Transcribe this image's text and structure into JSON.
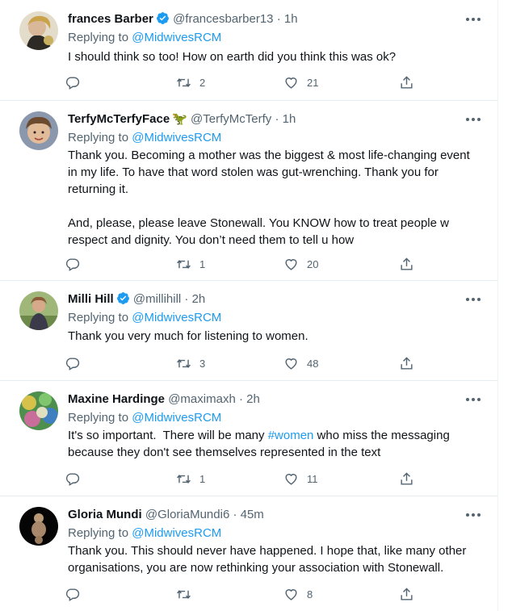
{
  "tweets": [
    {
      "name": "frances Barber",
      "verified": true,
      "emoji": "",
      "handle": "@francesbarber13",
      "time": "1h",
      "reply_prefix": "Replying to",
      "reply_handle": "@MidwivesRCM",
      "text_lines": [
        "I should think so too! How on earth did you think this was ok?"
      ],
      "counts": {
        "reply": "",
        "retweet": "2",
        "like": "21"
      },
      "avatar_colors": [
        "#d8c9a8",
        "#2d2a26"
      ]
    },
    {
      "name": "TerfyMcTerfyFace",
      "verified": false,
      "emoji": "🦖",
      "handle": "@TerfyMcTerfy",
      "time": "1h",
      "reply_prefix": "Replying to",
      "reply_handle": "@MidwivesRCM",
      "text_lines": [
        "Thank you. Becoming a mother was the biggest & most life-changing event",
        "in my life. To have that word stolen was gut-wrenching. Thank you for",
        "returning it.",
        "",
        "And, please, please leave Stonewall. You KNOW how to treat people w",
        "respect and dignity. You don’t need them to tell u how"
      ],
      "counts": {
        "reply": "",
        "retweet": "1",
        "like": "20"
      },
      "avatar_colors": [
        "#6e7f9a",
        "#d9b08c"
      ]
    },
    {
      "name": "Milli Hill",
      "verified": true,
      "emoji": "",
      "handle": "@millihill",
      "time": "2h",
      "reply_prefix": "Replying to",
      "reply_handle": "@MidwivesRCM",
      "text_lines": [
        "Thank you very much for listening to women."
      ],
      "counts": {
        "reply": "",
        "retweet": "3",
        "like": "48"
      },
      "avatar_colors": [
        "#7d9a5c",
        "#b58a6a"
      ]
    },
    {
      "name": "Maxine Hardinge",
      "verified": false,
      "emoji": "",
      "handle": "@maximaxh",
      "time": "2h",
      "reply_prefix": "Replying to",
      "reply_handle": "@MidwivesRCM",
      "text_before": "It's so important.  There will be many ",
      "hashtag": "#women",
      "text_after": " who miss the messaging",
      "text_lines": [
        "because they don't see themselves represented in the text"
      ],
      "counts": {
        "reply": "",
        "retweet": "1",
        "like": "11"
      },
      "avatar_colors": [
        "#5aa35a",
        "#c9b44a"
      ]
    },
    {
      "name": "Gloria Mundi",
      "verified": false,
      "emoji": "",
      "handle": "@GloriaMundi6",
      "time": "45m",
      "reply_prefix": "Replying to",
      "reply_handle": "@MidwivesRCM",
      "text_lines": [
        "Thank you. This should never have happened. I hope that, like many other",
        "organisations, you are now rethinking your association with Stonewall."
      ],
      "counts": {
        "reply": "",
        "retweet": "",
        "like": "8"
      },
      "avatar_colors": [
        "#0a0a0a",
        "#b89a78"
      ]
    }
  ],
  "colors": {
    "accent": "#1d9bf0",
    "muted": "#536471",
    "text": "#0f1419"
  },
  "icons": [
    "verified-badge-icon",
    "more-options-icon",
    "reply-icon",
    "retweet-icon",
    "like-icon",
    "share-icon"
  ]
}
